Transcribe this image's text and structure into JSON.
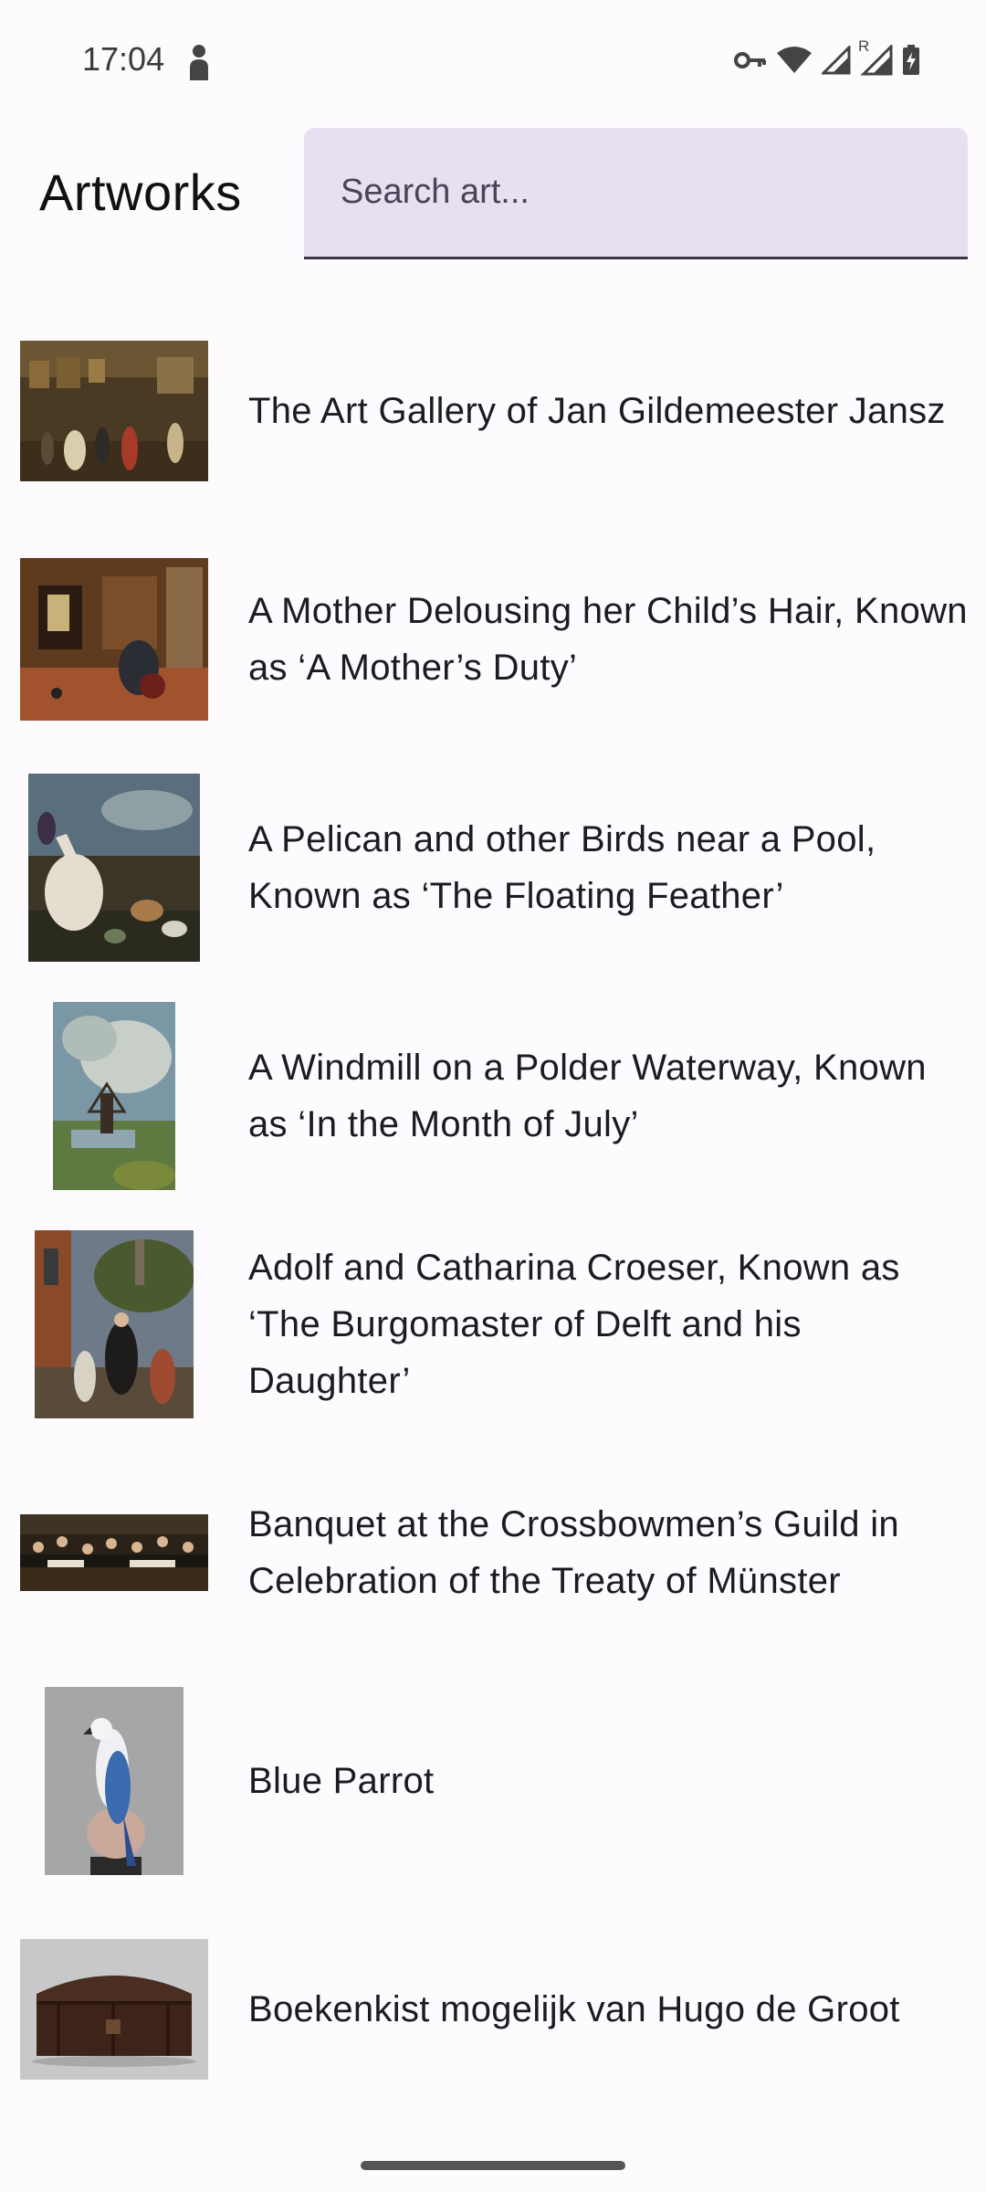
{
  "status_bar": {
    "time": "17:04",
    "roaming_indicator": "R",
    "icons": [
      "person-icon",
      "vpn-key-icon",
      "wifi-icon",
      "signal-icon",
      "signal-roaming-icon",
      "battery-charging-icon"
    ]
  },
  "header": {
    "title": "Artworks"
  },
  "search": {
    "placeholder": "Search art...",
    "value": ""
  },
  "artworks": [
    {
      "title": " The Art Gallery of Jan Gildemeester Jansz"
    },
    {
      "title": "A Mother Delousing her Child’s Hair, Known as ‘A Mother’s Duty’"
    },
    {
      "title": "A Pelican and other Birds near a Pool, Known as ‘The Floating Feather’"
    },
    {
      "title": "A Windmill on a Polder Waterway, Known as ‘In the Month of July’"
    },
    {
      "title": "Adolf and Catharina Croeser, Known as ‘The Burgomaster of Delft and his Daughter’"
    },
    {
      "title": "Banquet at the Crossbowmen’s Guild in Celebration of the Treaty of Münster"
    },
    {
      "title": "Blue Parrot"
    },
    {
      "title": "Boekenkist mogelijk van Hugo de Groot"
    }
  ],
  "colors": {
    "background": "#fdfbfe",
    "search_fill": "#e8dff0",
    "search_underline": "#3b3546",
    "text": "#1c1b1f"
  }
}
